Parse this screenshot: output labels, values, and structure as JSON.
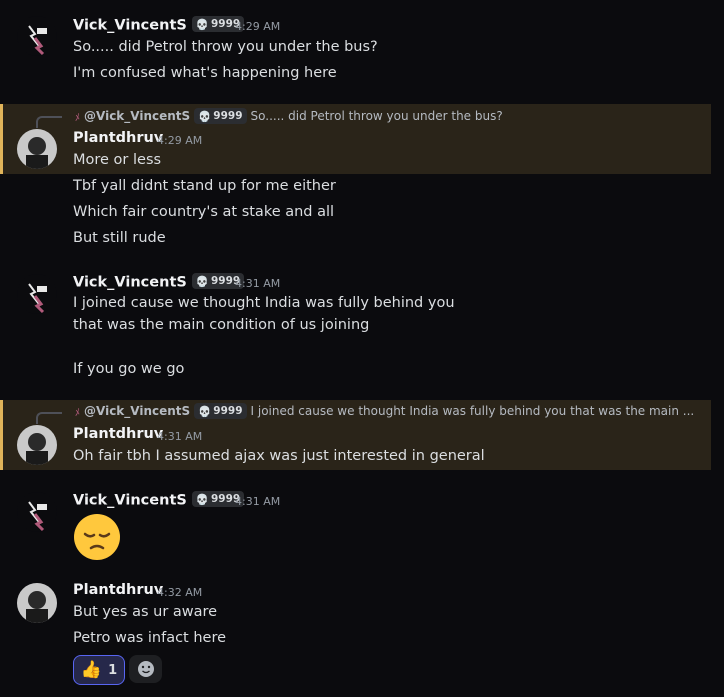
{
  "users": {
    "vick": {
      "name": "Vick_VincentS",
      "tag": "9999"
    },
    "plant": {
      "name": "Plantdhruv"
    }
  },
  "messages": [
    {
      "author": "Vick_VincentS",
      "tag": "9999",
      "time": "4:29 AM",
      "lines": [
        "So..... did Petrol throw you under the bus?",
        "I'm confused what's happening here"
      ]
    },
    {
      "author": "Plantdhruv",
      "time": "4:29 AM",
      "reply": {
        "name": "@Vick_VincentS",
        "tag": "9999",
        "text": "So..... did Petrol throw you under the bus?"
      },
      "lines": [
        "More or less",
        "Tbf yall didnt stand up for me either",
        "Which fair country's at stake and all",
        "But still rude"
      ]
    },
    {
      "author": "Vick_VincentS",
      "tag": "9999",
      "time": "4:31 AM",
      "lines": [
        "I joined cause we thought India was fully behind you",
        "that was the main condition of us joining",
        "If you go we go"
      ]
    },
    {
      "author": "Plantdhruv",
      "time": "4:31 AM",
      "reply": {
        "name": "@Vick_VincentS",
        "tag": "9999",
        "text": "I joined cause we thought India was fully behind you that was the main ..."
      },
      "lines": [
        "Oh fair tbh I assumed ajax was just interested in general"
      ]
    },
    {
      "author": "Vick_VincentS",
      "tag": "9999",
      "time": "4:31 AM",
      "emoji": "pensive-face"
    },
    {
      "author": "Plantdhruv",
      "time": "4:32 AM",
      "lines": [
        "But yes as ur aware",
        "Petro was infact here"
      ],
      "reaction": {
        "emoji": "thumbs-up",
        "count": "1"
      }
    }
  ],
  "colors": {
    "background": "#0b0b0e",
    "reply_highlight": "#2a2419",
    "reply_accent": "#e0b45a",
    "reaction_border": "#5865f2"
  }
}
